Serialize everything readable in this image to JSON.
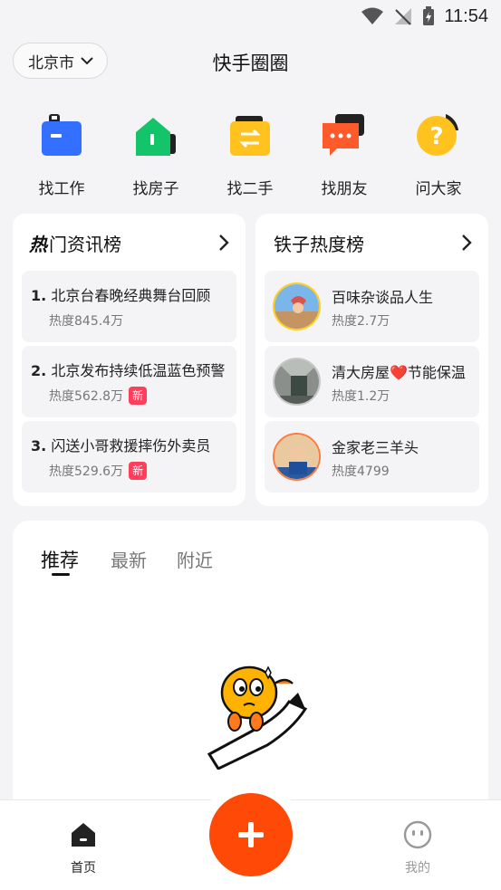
{
  "status": {
    "time": "11:54"
  },
  "header": {
    "city": "北京市",
    "title": "快手圈圈"
  },
  "quick_actions": [
    {
      "label": "找工作",
      "icon": "briefcase-icon"
    },
    {
      "label": "找房子",
      "icon": "house-icon"
    },
    {
      "label": "找二手",
      "icon": "exchange-icon"
    },
    {
      "label": "找朋友",
      "icon": "chat-icon"
    },
    {
      "label": "问大家",
      "icon": "question-icon"
    }
  ],
  "hot_news": {
    "title_prefix": "热",
    "title": "门资讯榜",
    "items": [
      {
        "rank": "1.",
        "text": "北京台春晚经典舞台回顾",
        "heat": "热度845.4万",
        "badge": ""
      },
      {
        "rank": "2.",
        "text": "北京发布持续低温蓝色预警",
        "heat": "热度562.8万",
        "badge": "新"
      },
      {
        "rank": "3.",
        "text": "闪送小哥救援摔伤外卖员",
        "heat": "热度529.6万",
        "badge": "新"
      }
    ]
  },
  "fans_rank": {
    "title": "铁子热度榜",
    "items": [
      {
        "name": "百味杂谈品人生",
        "heat": "热度2.7万"
      },
      {
        "name": "清大房屋❤️节能保温",
        "heat": "热度1.2万"
      },
      {
        "name": "金家老三羊头",
        "heat": "热度4799"
      }
    ]
  },
  "feed_tabs": [
    {
      "label": "推荐",
      "active": true
    },
    {
      "label": "最新",
      "active": false
    },
    {
      "label": "附近",
      "active": false
    }
  ],
  "tabbar": {
    "home": "首页",
    "mine": "我的"
  },
  "colors": {
    "accent": "#ff4906",
    "badge": "#ff3e5c",
    "avatar_ring": "#ffcf1e"
  }
}
